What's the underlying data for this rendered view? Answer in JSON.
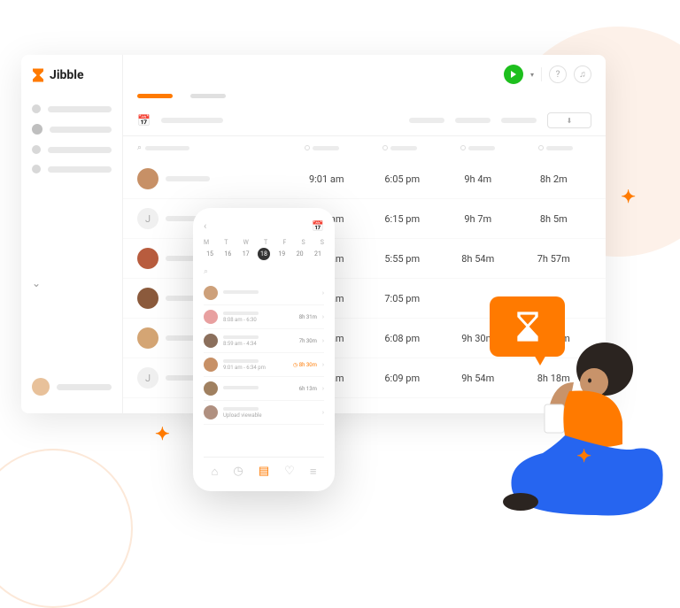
{
  "brand": {
    "name": "Jibble"
  },
  "header": {},
  "timesheet": {
    "rows": [
      {
        "initial": "",
        "in": "9:01 am",
        "out": "6:05 pm",
        "total": "9h 4m",
        "paid": "8h 2m",
        "av": "p1"
      },
      {
        "initial": "J",
        "in": "9:04 am",
        "out": "6:15 pm",
        "total": "9h 7m",
        "paid": "8h 5m",
        "av": "g"
      },
      {
        "initial": "",
        "in": "9:15 am",
        "out": "5:55 pm",
        "total": "8h 54m",
        "paid": "7h 57m",
        "av": "p2"
      },
      {
        "initial": "",
        "in": "8:01 am",
        "out": "7:05 pm",
        "total": "",
        "paid": "",
        "av": "p3"
      },
      {
        "initial": "",
        "in": "8:15 am",
        "out": "6:08 pm",
        "total": "9h 30m",
        "paid": "8h 15m",
        "av": "p4"
      },
      {
        "initial": "J",
        "in": "8:19 am",
        "out": "6:09 pm",
        "total": "9h 54m",
        "paid": "8h 18m",
        "av": "g"
      }
    ]
  },
  "mobile": {
    "weekdays": [
      "M",
      "T",
      "W",
      "T",
      "F",
      "S",
      "S"
    ],
    "days": [
      "15",
      "16",
      "17",
      "18",
      "19",
      "20",
      "21"
    ],
    "selected_day": "18",
    "entries": [
      {
        "time": "",
        "dur": "",
        "orange": false
      },
      {
        "time": "8:08 am - 6:30",
        "dur": "8h 31m",
        "orange": false
      },
      {
        "time": "8:59 am - 4:34",
        "dur": "7h 30m",
        "orange": false
      },
      {
        "time": "9:01 am - 6:34 pm",
        "dur": "8h 30m",
        "orange": true
      },
      {
        "time": "",
        "dur": "6h 13m",
        "orange": false
      },
      {
        "time": "Upload viewable",
        "dur": "",
        "orange": false
      }
    ]
  }
}
